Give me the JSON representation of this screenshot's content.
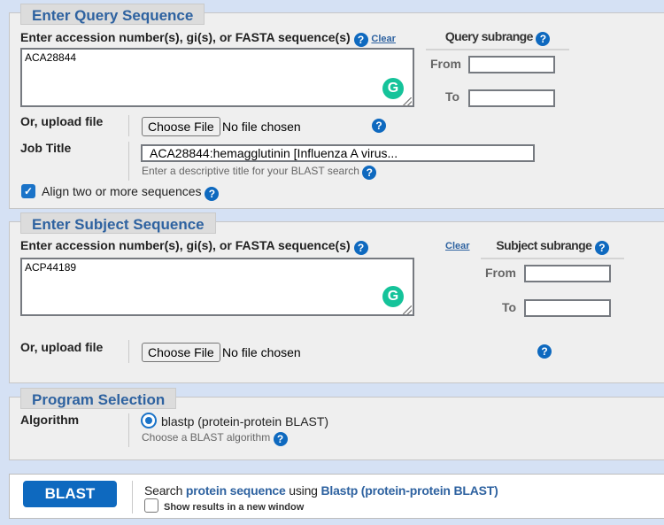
{
  "query": {
    "legend": "Enter Query Sequence",
    "accession_label": "Enter accession number(s), gi(s), or FASTA sequence(s)",
    "clear_label": "Clear",
    "sequence_value": "ACA28844",
    "subrange_title": "Query subrange",
    "from_label": "From",
    "to_label": "To",
    "from_value": "",
    "to_value": "",
    "upload_label": "Or, upload file",
    "choose_file_label": "Choose File",
    "no_file_label": "No file chosen",
    "job_title_label": "Job Title",
    "job_title_value": "ACA28844:hemagglutinin [Influenza A virus...",
    "job_title_hint": "Enter a descriptive title for your BLAST search",
    "align_label": "Align two or more sequences",
    "align_checked": true
  },
  "subject": {
    "legend": "Enter Subject Sequence",
    "accession_label": "Enter accession number(s), gi(s), or FASTA sequence(s)",
    "clear_label": "Clear",
    "sequence_value": "ACP44189",
    "subrange_title": "Subject subrange",
    "from_label": "From",
    "to_label": "To",
    "from_value": "",
    "to_value": "",
    "upload_label": "Or, upload file",
    "choose_file_label": "Choose File",
    "no_file_label": "No file chosen"
  },
  "program": {
    "legend": "Program Selection",
    "algorithm_label": "Algorithm",
    "algorithm_option": "blastp (protein-protein BLAST)",
    "algorithm_hint": "Choose a BLAST algorithm"
  },
  "submit": {
    "blast_label": "BLAST",
    "search_prefix": "Search",
    "search_target": "protein sequence",
    "search_using": "using",
    "search_program": "Blastp (protein-protein BLAST)",
    "new_window_label": "Show results in a new window",
    "new_window_checked": false
  },
  "icons": {
    "help": "?",
    "grammarly": "G",
    "check": "✓"
  }
}
